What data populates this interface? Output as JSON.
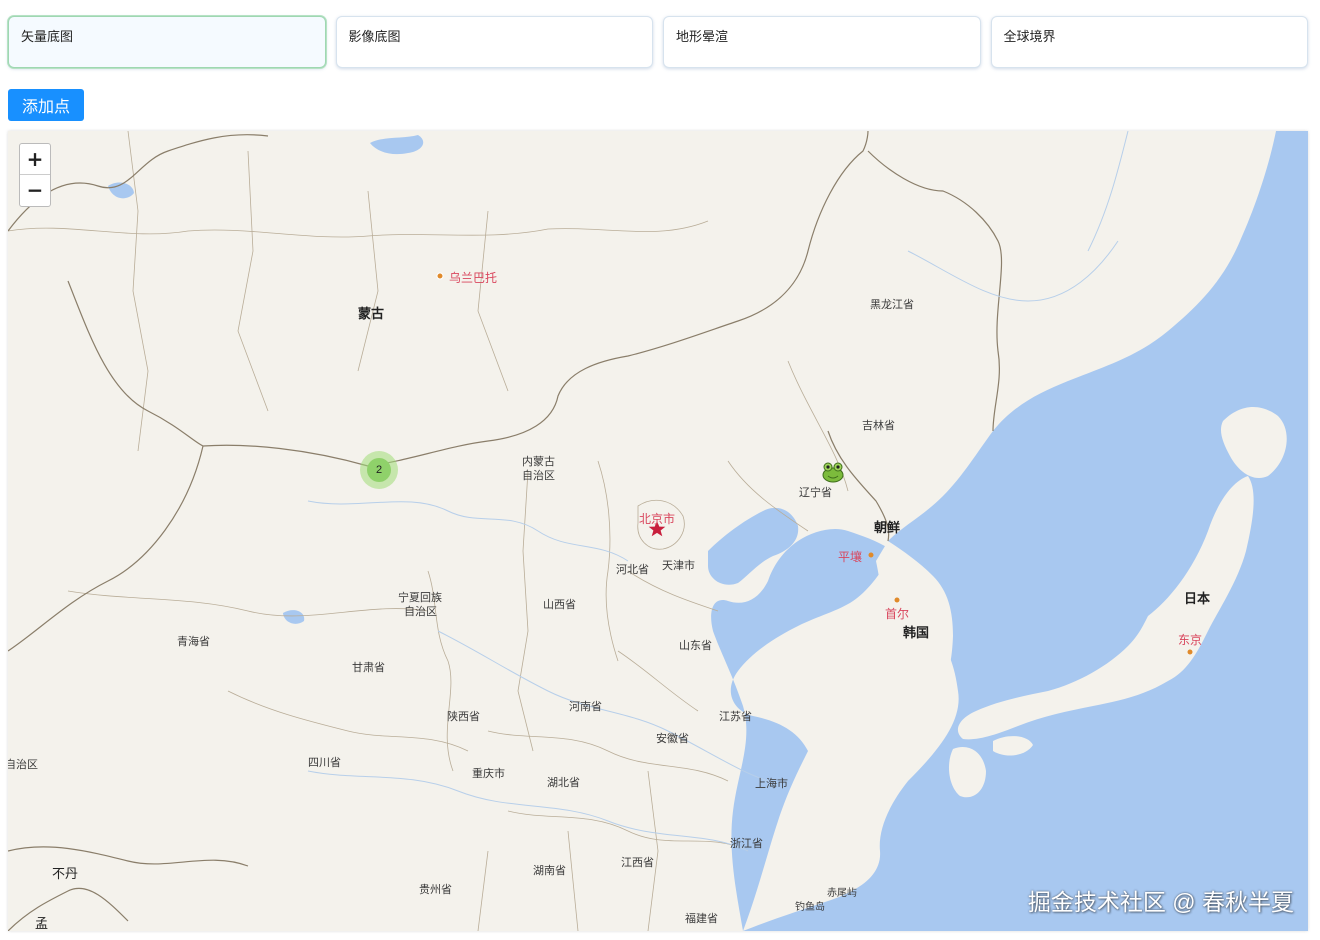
{
  "layer_tabs": [
    {
      "label": "矢量底图",
      "active": true
    },
    {
      "label": "影像底图",
      "active": false
    },
    {
      "label": "地形晕渲",
      "active": false
    },
    {
      "label": "全球境界",
      "active": false
    }
  ],
  "add_point_label": "添加点",
  "zoom": {
    "in_label": "+",
    "out_label": "−"
  },
  "labels": {
    "mongolia": "蒙古",
    "ulaanbaatar": "乌兰巴托",
    "heilongjiang": "黑龙江省",
    "jilin": "吉林省",
    "liaoning": "辽宁省",
    "inner_mongolia_1": "内蒙古",
    "inner_mongolia_2": "自治区",
    "beijing": "北京市",
    "tianjin": "天津市",
    "hebei": "河北省",
    "shanxi": "山西省",
    "ningxia_1": "宁夏回族",
    "ningxia_2": "自治区",
    "qinghai": "青海省",
    "gansu": "甘肃省",
    "shaanxi": "陕西省",
    "henan": "河南省",
    "shandong": "山东省",
    "jiangsu": "江苏省",
    "anhui": "安徽省",
    "shanghai": "上海市",
    "hubei": "湖北省",
    "chongqing": "重庆市",
    "sichuan": "四川省",
    "zhejiang": "浙江省",
    "jiangxi": "江西省",
    "hunan": "湖南省",
    "guizhou": "贵州省",
    "fujian": "福建省",
    "xizang_edge": "自治区",
    "bhutan": "不丹",
    "bangla_edge": "孟",
    "north_korea": "朝鲜",
    "pyongyang": "平壤",
    "seoul": "首尔",
    "south_korea": "韩国",
    "japan": "日本",
    "tokyo": "东京",
    "chiwei": "赤尾屿",
    "diaoyu": "钓鱼岛"
  },
  "cluster": {
    "count": "2"
  },
  "watermark": "掘金技术社区 @ 春秋半夏",
  "colors": {
    "sea": "#a8c8f0",
    "land": "#f4f2ec",
    "border": "#8a7e6a",
    "capital": "#d9465d",
    "button": "#1890ff",
    "cluster": "#8fd16a"
  },
  "icons": [
    "zoom-in-icon",
    "zoom-out-icon",
    "capital-star-icon",
    "city-dot-icon",
    "frog-marker-icon"
  ]
}
